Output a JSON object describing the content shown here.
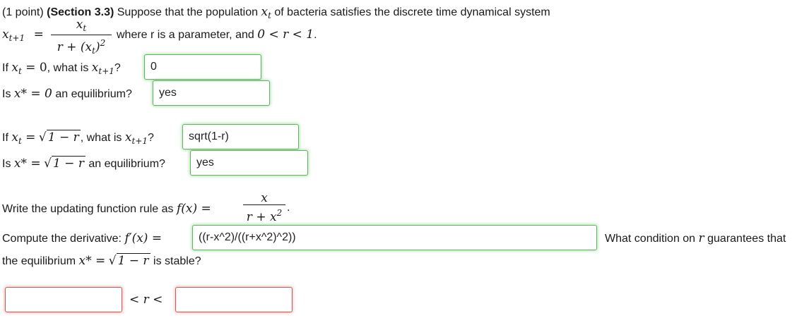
{
  "problem": {
    "points": "(1 point)",
    "section": "(Section 3.3)",
    "intro": "Suppose that the population",
    "intro_var": "x",
    "intro_var_sub": "t",
    "intro_end": "of bacteria satisfies the discrete time dynamical system",
    "eq_lhs": "x",
    "eq_lhs_sub": "t+1",
    "eq_equals": "=",
    "frac_num": "x",
    "frac_num_sub": "t",
    "frac_den_a": "r + (x",
    "frac_den_sub": "t",
    "frac_den_b": ")",
    "frac_den_sup": "2",
    "where_text": "where r is a parameter, and",
    "where_math": "0 < r < 1",
    "where_end": "."
  },
  "q1": {
    "prefix": "If",
    "math": "x",
    "math_sub": "t",
    "math_rest": "= 0",
    "mid": ", what is",
    "ask": "x",
    "ask_sub": "t+1",
    "q": "?",
    "answer": "0"
  },
  "q2": {
    "prefix": "Is",
    "math": "x* = 0",
    "suffix": "an equilibrium?",
    "answer": "yes"
  },
  "q3": {
    "prefix": "If",
    "math": "x",
    "math_sub": "t",
    "math_eq": "=",
    "sqrt_content": "1 − r",
    "mid": ", what is",
    "ask": "x",
    "ask_sub": "t+1",
    "q": "?",
    "answer": "sqrt(1-r)"
  },
  "q4": {
    "prefix": "Is",
    "math": "x* =",
    "sqrt_content": "1 − r",
    "suffix": "an equilibrium?",
    "answer": "yes"
  },
  "q5": {
    "prefix": "Write the updating function rule as",
    "math": "f(x) =",
    "frac_num": "x",
    "frac_den": "r + x",
    "frac_den_sup": "2",
    "end": "."
  },
  "q6": {
    "prefix": "Compute the derivative:",
    "math": "f′(x) =",
    "answer": "((r-x^2)/((r+x^2)^2))",
    "after": "What condition on",
    "after_var": "r",
    "after_end": "guarantees that",
    "line2_prefix": "the equilibrium",
    "line2_math": "x* =",
    "sqrt_content": "1 − r",
    "line2_end": "is stable?"
  },
  "q7": {
    "lower": "",
    "middle": "< r <",
    "upper": ""
  }
}
